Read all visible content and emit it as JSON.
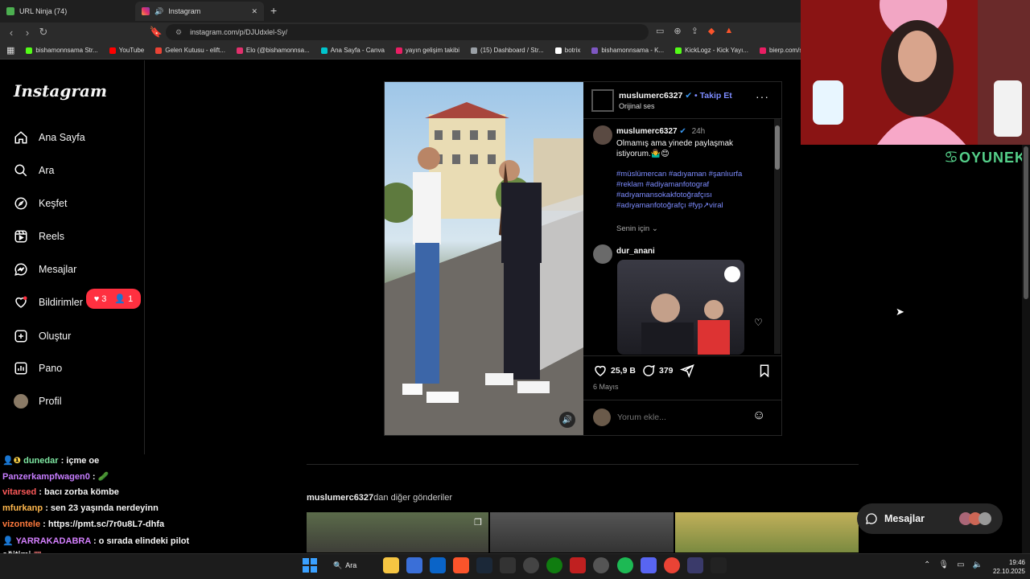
{
  "browser": {
    "tabs": [
      {
        "title": "URL Ninja (74)"
      },
      {
        "title": "Instagram"
      }
    ],
    "url": "instagram.com/p/DJUdxlel-Sy/",
    "bookmarks": [
      "bishamonnsama Str...",
      "YouTube",
      "Gelen Kutusu - elift...",
      "Elo (@bishamonnsa...",
      "Ana Sayfa - Canva",
      "yayın gelişim takibi",
      "(15) Dashboard / Str...",
      "botrix",
      "bishamonnsama - K...",
      "KickLogz - Kick Yayı...",
      "bierp.com/s"
    ]
  },
  "sidebar": {
    "logo": "Instagram",
    "items": [
      {
        "label": "Ana Sayfa",
        "icon": "home-icon"
      },
      {
        "label": "Ara",
        "icon": "search-icon"
      },
      {
        "label": "Keşfet",
        "icon": "compass-icon"
      },
      {
        "label": "Reels",
        "icon": "reels-icon"
      },
      {
        "label": "Mesajlar",
        "icon": "messenger-icon"
      },
      {
        "label": "Bildirimler",
        "icon": "heart-icon"
      },
      {
        "label": "Oluştur",
        "icon": "plus-square-icon"
      },
      {
        "label": "Pano",
        "icon": "dashboard-icon"
      },
      {
        "label": "Profil",
        "icon": "avatar"
      }
    ],
    "notification_badge": {
      "likes": "3",
      "follows": "1"
    }
  },
  "post": {
    "author": "muslumerc6327",
    "follow_label": "Takip Et",
    "audio": "Orijinal ses",
    "caption_author": "muslumerc6327",
    "caption_time": "24h",
    "caption": "Olmamış ama yinede paylaşmak istiyorum.🤷‍♂️😊",
    "hashtags": "#müslümercan #adıyaman  #şanlıurfa #reklam #adiyamanfotograf #adıyamansokakfotoğrafçısı #adıyamanfotoğrafçı #fyp↗viral",
    "translation_toggle": "Senin için",
    "comment_user": "dur_anani",
    "likes": "25,9 B",
    "comments_count": "379",
    "date": "6 Mayıs",
    "comment_placeholder": "Yorum ekle..."
  },
  "more_posts_title": "muslumerc6327",
  "more_posts_suffix": "dan diğer gönderiler",
  "messages_button": "Mesajlar",
  "stream": {
    "brand": "OYUNEKS",
    "chat": [
      {
        "user": "dunedar",
        "msg": ": içme oe",
        "color": "#7ee7a2"
      },
      {
        "user": "Panzerkampfwagen0",
        "msg": ":",
        "color": "#c77dff"
      },
      {
        "user": "vitarsed",
        "msg": ": bacı zorba kömbe",
        "color": "#ff5a5a"
      },
      {
        "user": "mfurkanp",
        "msg": ": sen 23 yaşında nerdeyinn",
        "color": "#ffb84d"
      },
      {
        "user": "vizontele",
        "msg": ": https://pmt.sc/7r0u8L7-dhfa",
        "color": "#ff7a3d"
      },
      {
        "user": "YARRAKADABRA",
        "msg": ": o sırada elindeki pilot",
        "color": "#d580ff"
      },
      {
        "user": "",
        "msg": "eğitimi",
        "color": "#ffffff"
      }
    ]
  },
  "taskbar": {
    "search_label": "Ara",
    "time": "19:46",
    "date": "22.10.2025"
  }
}
